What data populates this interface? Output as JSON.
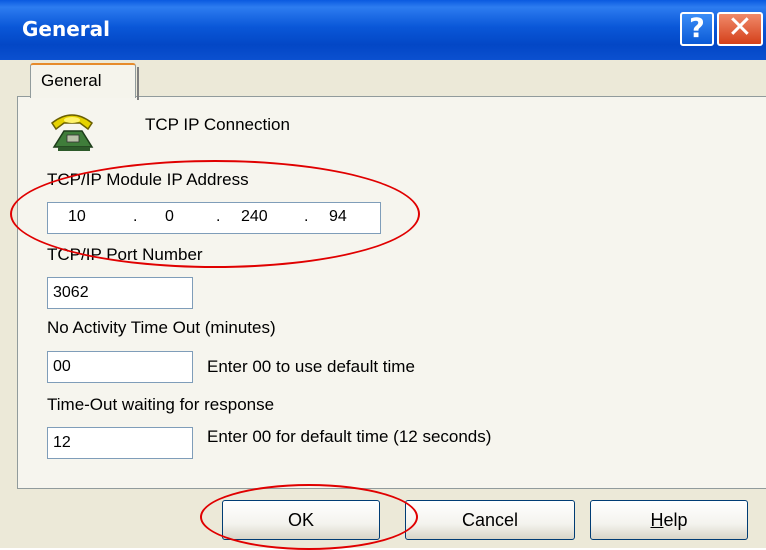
{
  "window": {
    "title": "General"
  },
  "tabs": [
    {
      "label": "General"
    }
  ],
  "connection": {
    "title": "TCP IP Connection",
    "icon": "telephone-icon"
  },
  "ip_address": {
    "label": "TCP/IP Module IP Address",
    "octets": [
      "10",
      "0",
      "240",
      "94"
    ],
    "separator": "."
  },
  "port": {
    "label": "TCP/IP Port Number",
    "value": "3062"
  },
  "no_activity": {
    "label": "No Activity Time Out (minutes)",
    "value": "00",
    "hint": "Enter 00 to use default time"
  },
  "response_timeout": {
    "label": "Time-Out waiting for response",
    "value": "12",
    "hint": "Enter 00 for default time (12 seconds)"
  },
  "buttons": {
    "ok": "OK",
    "cancel": "Cancel",
    "help_first": "H",
    "help_rest": "elp"
  },
  "titlebar_buttons": {
    "help": "?",
    "close": "✕"
  },
  "colors": {
    "titlebar": "#0a57d8",
    "dialog_bg": "#ece9d8",
    "annotation": "#e00000"
  }
}
